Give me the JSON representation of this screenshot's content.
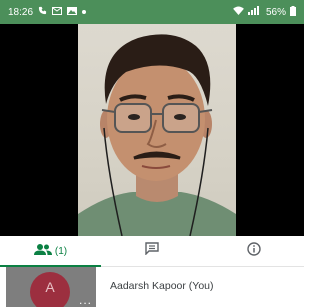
{
  "status_bar": {
    "time": "18:26",
    "battery": "56%",
    "left_icons": [
      "phone-icon",
      "message-icon",
      "photo-icon",
      "dot-icon"
    ],
    "right_icons": [
      "wifi-icon",
      "signal-icon",
      "battery-icon"
    ],
    "background": "#4c8f5a"
  },
  "tabs": [
    {
      "name": "people",
      "icon": "people-icon",
      "count": "(1)",
      "active": true
    },
    {
      "name": "chat",
      "icon": "chat-icon"
    },
    {
      "name": "info",
      "icon": "info-icon"
    }
  ],
  "participant": {
    "initial": "A",
    "name": "Aadarsh Kapoor (You)",
    "more": "..."
  },
  "colors": {
    "accent": "#0b8043",
    "avatar": "#9c2f3f"
  }
}
